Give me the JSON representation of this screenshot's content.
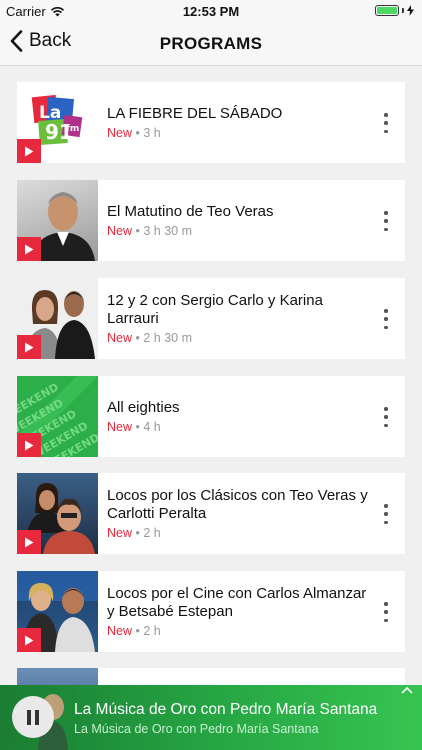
{
  "status_bar": {
    "carrier": "Carrier",
    "time": "12:53 PM"
  },
  "nav": {
    "back_label": "Back",
    "title": "PROGRAMS"
  },
  "programs": [
    {
      "title": "LA FIEBRE DEL SÁBADO",
      "new_label": "New",
      "separator": "•",
      "duration": "3 h"
    },
    {
      "title": "El Matutino de Teo Veras",
      "new_label": "New",
      "separator": "•",
      "duration": "3 h 30 m"
    },
    {
      "title": "12 y 2 con Sergio Carlo y Karina Larrauri",
      "new_label": "New",
      "separator": "•",
      "duration": "2 h 30 m"
    },
    {
      "title": "All eighties",
      "new_label": "New",
      "separator": "•",
      "duration": "4 h"
    },
    {
      "title": "Locos por los Clásicos con Teo Veras y Carlotti Peralta",
      "new_label": "New",
      "separator": "•",
      "duration": "2 h"
    },
    {
      "title": "Locos por el Cine con Carlos Almanzar y Betsabé Estepan",
      "new_label": "New",
      "separator": "•",
      "duration": "2 h"
    }
  ],
  "player": {
    "title": "La Música de Oro con Pedro María Santana",
    "subtitle": "La Música de Oro con Pedro María Santana",
    "state": "playing"
  },
  "logo_text": "La 91 fm",
  "thumb_text": "WEEKEND",
  "colors": {
    "accent_red": "#e8283c",
    "player_green": "#27a844",
    "background": "#f0f0f0"
  },
  "icons": [
    "wifi-icon",
    "battery-icon",
    "charging-bolt-icon",
    "chevron-left-icon",
    "play-icon",
    "more-vertical-icon",
    "pause-icon",
    "chevron-up-icon"
  ]
}
